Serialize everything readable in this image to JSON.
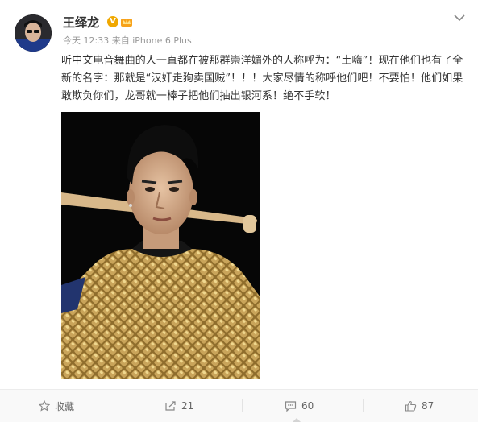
{
  "post": {
    "author": "王绎龙",
    "verified_badge": "V",
    "timestamp": "今天 12:33",
    "source_prefix": "来自",
    "source_device": "iPhone 6 Plus",
    "text": "听中文电音舞曲的人一直都在被那群崇洋媚外的人称呼为：“土嗨”！现在他们也有了全新的名字：那就是“汉奸走狗卖国贼”！！！大家尽情的称呼他们吧！不要怕！他们如果敢欺负你们，龙哥就一棒子把他们抽出银河系！绝不手软！"
  },
  "actions": {
    "favorite_label": "收藏",
    "repost_count": "21",
    "comment_count": "60",
    "like_count": "87"
  },
  "colors": {
    "verified": "#f0a800",
    "gold_shirt": "#b8924a",
    "background": "#ffffff",
    "action_bar": "#f9f9f9"
  },
  "icons": [
    "star-icon",
    "repost-icon",
    "comment-icon",
    "like-icon",
    "chevron-down-icon",
    "crown-icon"
  ]
}
